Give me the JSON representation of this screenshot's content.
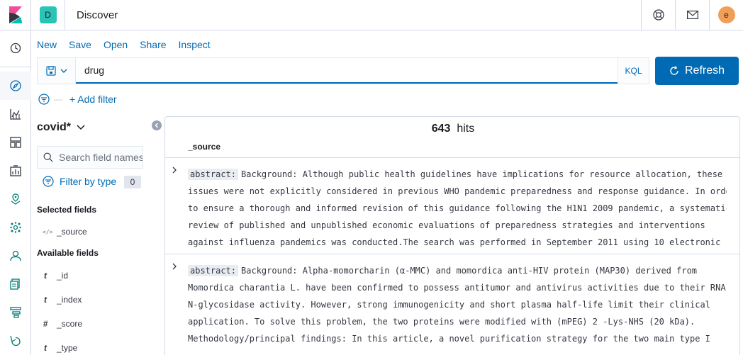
{
  "header": {
    "space_initial": "D",
    "title": "Discover",
    "user_initial": "e",
    "icons": [
      "help-icon",
      "mail-icon"
    ]
  },
  "leftnav": {
    "items": [
      "clock-icon",
      "compass-icon",
      "visualize-icon",
      "dashboard-icon",
      "canvas-icon",
      "maps-icon",
      "ml-icon",
      "metrics-icon",
      "logs-icon",
      "apm-icon",
      "uptime-icon"
    ]
  },
  "topmenu": {
    "new": "New",
    "save": "Save",
    "open": "Open",
    "share": "Share",
    "inspect": "Inspect"
  },
  "query": {
    "value": "drug",
    "language": "KQL"
  },
  "refresh": {
    "label": "Refresh"
  },
  "filters": {
    "add_label": "+ Add filter"
  },
  "sidebar": {
    "index_pattern": "covid*",
    "search_placeholder": "Search field names",
    "filter_by_type": "Filter by type",
    "filter_count": "0",
    "selected_title": "Selected fields",
    "selected_fields": [
      {
        "type": "</>",
        "name": "_source"
      }
    ],
    "available_title": "Available fields",
    "available_fields": [
      {
        "type": "t",
        "name": "_id"
      },
      {
        "type": "t",
        "name": "_index"
      },
      {
        "type": "#",
        "name": "_score"
      },
      {
        "type": "t",
        "name": "_type"
      }
    ]
  },
  "results": {
    "hits_count": "643",
    "hits_label": "hits",
    "column": "_source",
    "documents": [
      {
        "key": "abstract:",
        "lines": [
          "Background: Although public health guidelines have implications for resource allocation, these",
          "issues were not explicitly considered in previous WHO pandemic preparedness and response guidance. In order",
          "to ensure a thorough and informed revision of this guidance following the H1N1 2009 pandemic, a systematic",
          "review of published and unpublished economic evaluations of preparedness strategies and interventions",
          "against influenza pandemics was conducted.The search was performed in September 2011 using 10 electronic"
        ]
      },
      {
        "key": "abstract:",
        "lines": [
          "Background: Alpha-momorcharin (α-MMC) and momordica anti-HIV protein (MAP30) derived from",
          "Momordica charantia L. have been confirmed to possess antitumor and antivirus activities due to their RNA-",
          "N-glycosidase activity. However, strong immunogenicity and short plasma half-life limit their clinical",
          "application. To solve this problem, the two proteins were modified with (mPEG) 2 -Lys-NHS (20 kDa).",
          "Methodology/principal findings: In this article, a novel purification strategy for the two main type I"
        ]
      }
    ]
  }
}
